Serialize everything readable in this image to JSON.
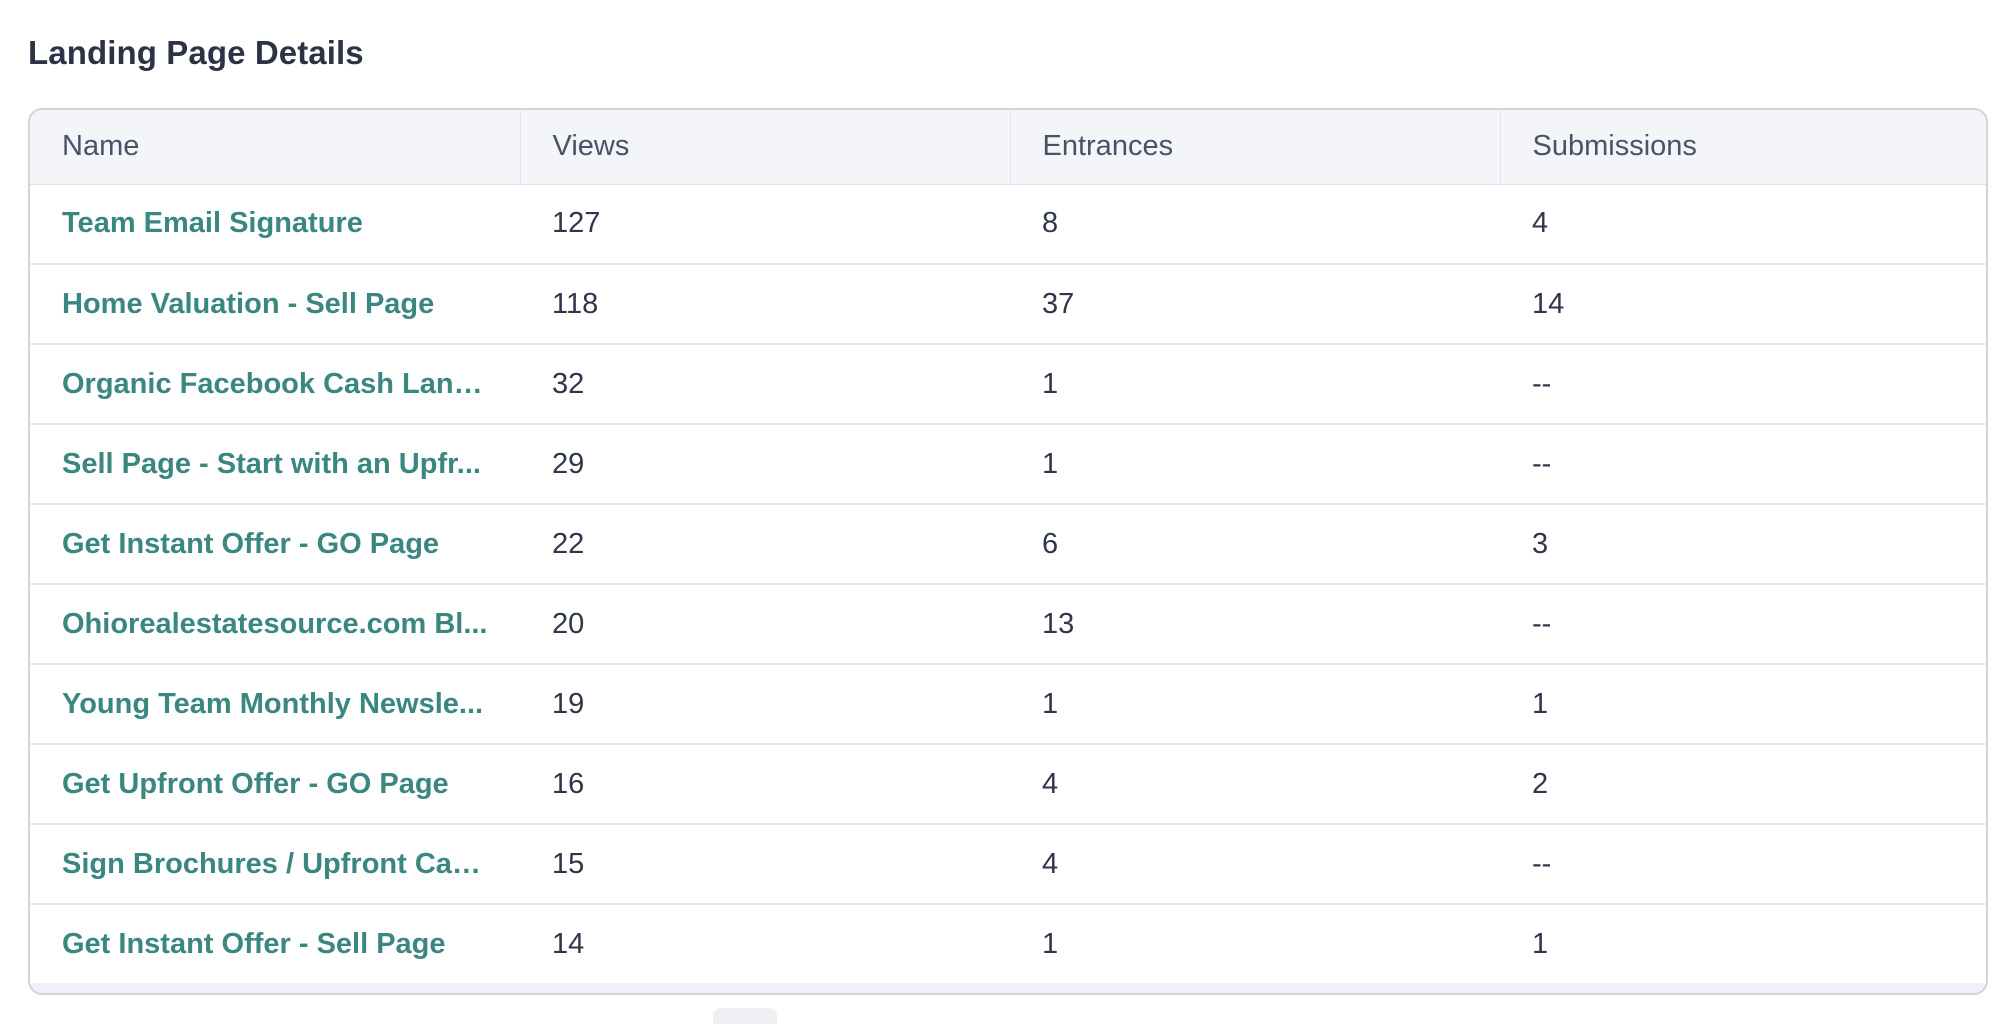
{
  "section": {
    "title": "Landing Page Details"
  },
  "table": {
    "columns": [
      "Name",
      "Views",
      "Entrances",
      "Submissions"
    ],
    "rows": [
      {
        "name": "Team Email Signature",
        "views": "127",
        "entrances": "8",
        "submissions": "4"
      },
      {
        "name": "Home Valuation - Sell Page",
        "views": "118",
        "entrances": "37",
        "submissions": "14"
      },
      {
        "name": "Organic Facebook Cash Land...",
        "views": "32",
        "entrances": "1",
        "submissions": "--"
      },
      {
        "name": "Sell Page - Start with an Upfr...",
        "views": "29",
        "entrances": "1",
        "submissions": "--"
      },
      {
        "name": "Get Instant Offer - GO Page",
        "views": "22",
        "entrances": "6",
        "submissions": "3"
      },
      {
        "name": "Ohiorealestatesource.com Bl...",
        "views": "20",
        "entrances": "13",
        "submissions": "--"
      },
      {
        "name": "Young Team Monthly Newsle...",
        "views": "19",
        "entrances": "1",
        "submissions": "1"
      },
      {
        "name": "Get Upfront Offer - GO Page",
        "views": "16",
        "entrances": "4",
        "submissions": "2"
      },
      {
        "name": "Sign Brochures / Upfront Cas...",
        "views": "15",
        "entrances": "4",
        "submissions": "--"
      },
      {
        "name": "Get Instant Offer - Sell Page",
        "views": "14",
        "entrances": "1",
        "submissions": "1"
      }
    ]
  },
  "colors": {
    "link": "#3a8680",
    "header_bg": "#f3f5f8",
    "text": "#30364a"
  }
}
